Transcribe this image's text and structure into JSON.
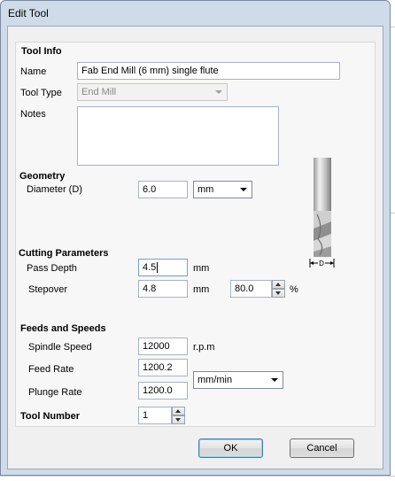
{
  "window": {
    "title": "Edit Tool"
  },
  "tool_info": {
    "heading": "Tool Info",
    "name_label": "Name",
    "name_value": "Fab End Mill (6 mm) single flute",
    "type_label": "Tool Type",
    "type_value": "End Mill",
    "notes_label": "Notes",
    "notes_value": ""
  },
  "geometry": {
    "heading": "Geometry",
    "diameter_label": "Diameter (D)",
    "diameter_value": "6.0",
    "unit_value": "mm",
    "diagram_label": "D"
  },
  "cutting": {
    "heading": "Cutting Parameters",
    "pass_depth_label": "Pass Depth",
    "pass_depth_value": "4.5",
    "pass_depth_unit": "mm",
    "stepover_label": "Stepover",
    "stepover_value": "4.8",
    "stepover_unit": "mm",
    "stepover_percent_value": "80.0",
    "percent_sign": "%"
  },
  "feeds": {
    "heading": "Feeds and Speeds",
    "spindle_label": "Spindle Speed",
    "spindle_value": "12000",
    "spindle_unit": "r.p.m",
    "feed_label": "Feed Rate",
    "feed_value": "1200.2",
    "plunge_label": "Plunge Rate",
    "plunge_value": "1200.0",
    "rate_unit_value": "mm/min"
  },
  "tool_number": {
    "label": "Tool Number",
    "value": "1"
  },
  "buttons": {
    "ok": "OK",
    "cancel": "Cancel"
  }
}
